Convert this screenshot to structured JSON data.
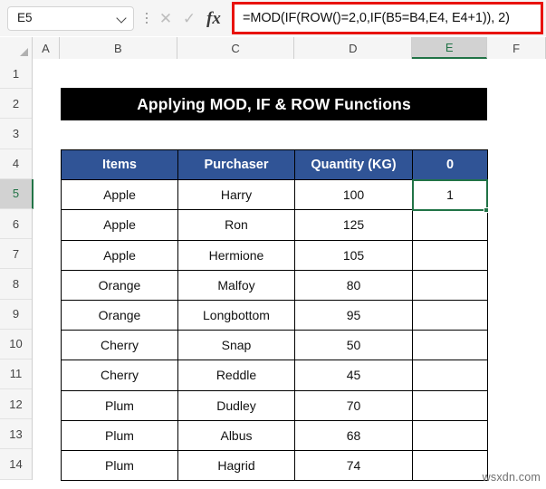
{
  "formula_bar": {
    "name_box_value": "E5",
    "name_box_dropdown_icon": "chevron-down-icon",
    "kebab_icon": "more-options-icon",
    "cancel_icon": "✕",
    "enter_icon": "✓",
    "fx_label": "fx",
    "formula": "=MOD(IF(ROW()=2,0,IF(B5=B4,E4, E4+1)), 2)",
    "highlight_color": "#e8120c"
  },
  "grid": {
    "columns": [
      "A",
      "B",
      "C",
      "D",
      "E",
      "F"
    ],
    "selected_column": "E",
    "rows": [
      "1",
      "2",
      "3",
      "4",
      "5",
      "6",
      "7",
      "8",
      "9",
      "10",
      "11",
      "12",
      "13",
      "14"
    ],
    "selected_row": "5",
    "selected_cell": "E5",
    "selection_color": "#217346"
  },
  "banner": {
    "title": "Applying MOD, IF & ROW Functions",
    "background": "#000000",
    "text_color": "#ffffff"
  },
  "table": {
    "header_color": "#305496",
    "headers": [
      "Items",
      "Purchaser",
      "Quantity (KG)",
      "0"
    ],
    "rows": [
      {
        "items": "Apple",
        "purchaser": "Harry",
        "quantity": "100",
        "flag": "1"
      },
      {
        "items": "Apple",
        "purchaser": "Ron",
        "quantity": "125",
        "flag": ""
      },
      {
        "items": "Apple",
        "purchaser": "Hermione",
        "quantity": "105",
        "flag": ""
      },
      {
        "items": "Orange",
        "purchaser": "Malfoy",
        "quantity": "80",
        "flag": ""
      },
      {
        "items": "Orange",
        "purchaser": "Longbottom",
        "quantity": "95",
        "flag": ""
      },
      {
        "items": "Cherry",
        "purchaser": "Snap",
        "quantity": "50",
        "flag": ""
      },
      {
        "items": "Cherry",
        "purchaser": "Reddle",
        "quantity": "45",
        "flag": ""
      },
      {
        "items": "Plum",
        "purchaser": "Dudley",
        "quantity": "70",
        "flag": ""
      },
      {
        "items": "Plum",
        "purchaser": "Albus",
        "quantity": "68",
        "flag": ""
      },
      {
        "items": "Plum",
        "purchaser": "Hagrid",
        "quantity": "74",
        "flag": ""
      }
    ]
  },
  "watermark": {
    "text": "wsxdn.com"
  }
}
